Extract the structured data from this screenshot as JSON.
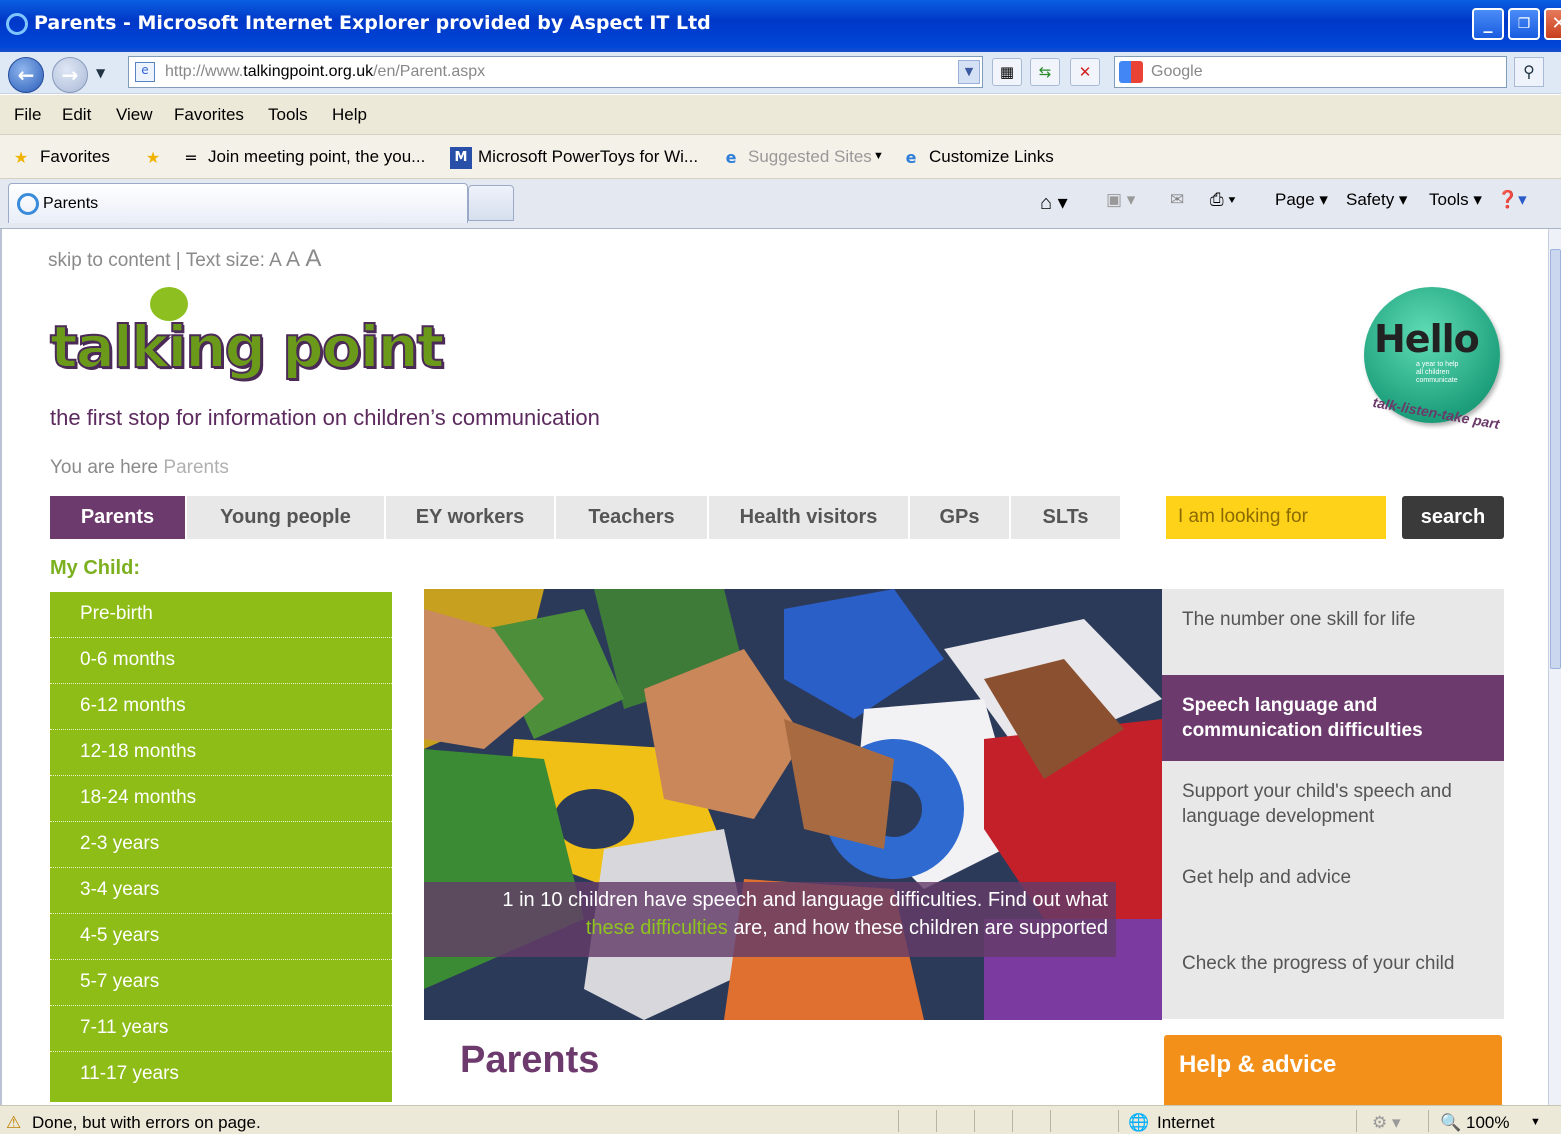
{
  "window": {
    "title": "Parents - Microsoft Internet Explorer provided by Aspect IT Ltd"
  },
  "address_bar": {
    "url_prefix": "http://www.",
    "url_domain": "talkingpoint.org.uk",
    "url_path": "/en/Parent.aspx"
  },
  "search_bar": {
    "placeholder": "Google"
  },
  "menu": [
    "File",
    "Edit",
    "View",
    "Favorites",
    "Tools",
    "Help"
  ],
  "favorites_bar": {
    "favorites_label": "Favorites",
    "links": [
      "Join meeting point, the you...",
      "Microsoft PowerToys for Wi...",
      "Suggested Sites",
      "Customize Links"
    ]
  },
  "tab": {
    "title": "Parents"
  },
  "command_bar": {
    "page": "Page",
    "safety": "Safety",
    "tools": "Tools"
  },
  "site": {
    "utility": {
      "skip": "skip to content",
      "text_size": "Text size:",
      "sizes": [
        "A",
        "A",
        "A"
      ]
    },
    "logo_text": "talking point",
    "tagline": "the first stop for information on children’s communication",
    "badge": {
      "title": "Hello",
      "subtitle": "talk-listen-take part",
      "small": "a year to help all children communicate"
    },
    "breadcrumb": {
      "label": "You are here",
      "current": "Parents"
    },
    "nav": [
      "Parents",
      "Young people",
      "EY workers",
      "Teachers",
      "Health visitors",
      "GPs",
      "SLTs"
    ],
    "search": {
      "placeholder": "I am looking for",
      "button": "search"
    },
    "my_child_label": "My Child:",
    "age_menu": [
      "Pre-birth",
      "0-6 months",
      "6-12 months",
      "12-18 months",
      "18-24 months",
      "2-3 years",
      "3-4 years",
      "4-5 years",
      "5-7 years",
      "7-11 years",
      "11-17 years"
    ],
    "hero_caption": {
      "part1": "1 in 10 children have speech and language difficulties. Find out what",
      "link": "these difficulties",
      "part2": "are, and how these children are supported"
    },
    "right_panel": [
      "The number one skill for life",
      "Speech language and communication difficulties",
      "Support your child's speech and language development",
      "Get help and advice",
      "Check the progress of your child"
    ],
    "page_title": "Parents",
    "help_box": "Help & advice"
  },
  "status_bar": {
    "message": "Done, but with errors on page.",
    "zone": "Internet",
    "zoom": "100%"
  },
  "colors": {
    "brand_purple": "#6d3a6e",
    "brand_green": "#8dbd16",
    "search_yellow": "#ffd21a",
    "help_orange": "#f39019"
  }
}
